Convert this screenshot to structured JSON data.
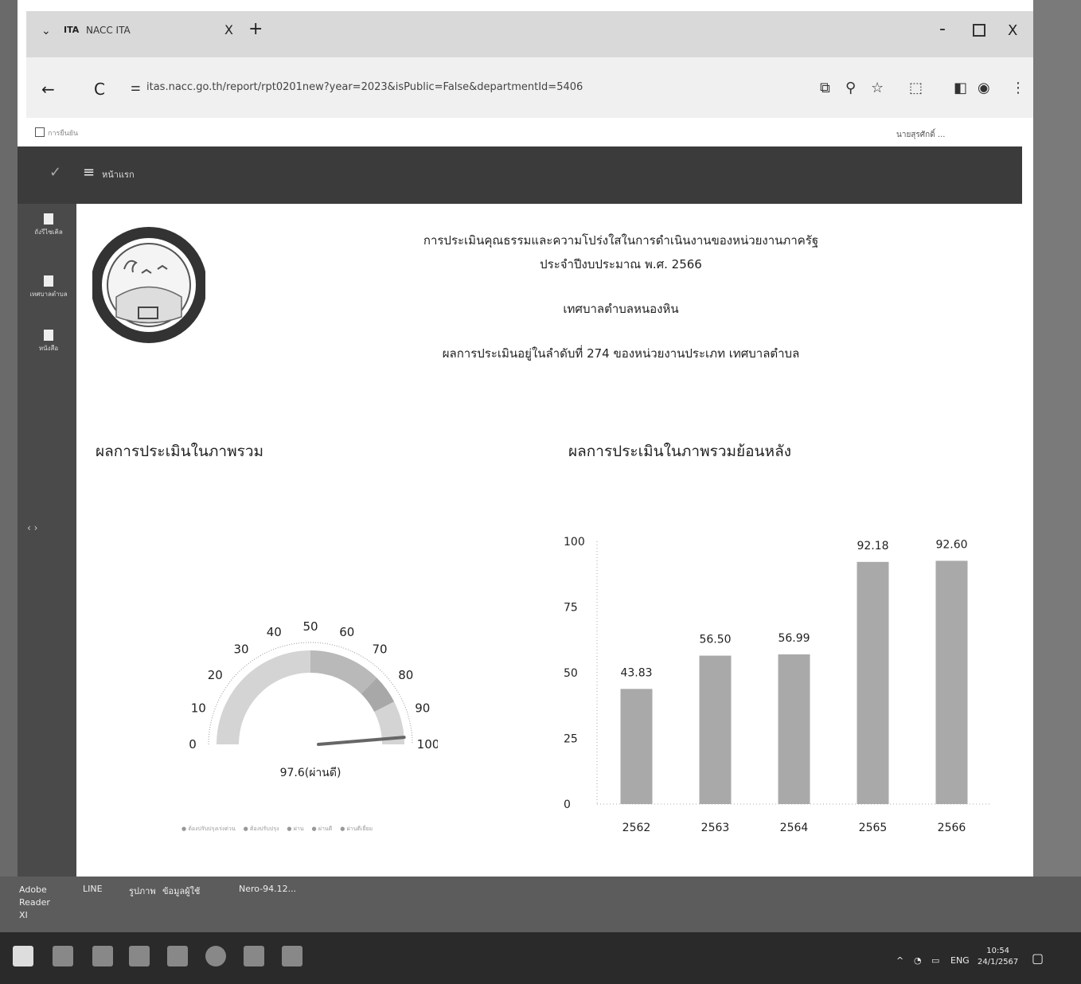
{
  "browser": {
    "tab_arrow": "⌄",
    "favicon_text": "ITA",
    "tab_title": "NACC ITA",
    "tab_close": "X",
    "tab_new": "+",
    "win_min": "-",
    "win_close": "X",
    "url": "itas.nacc.go.th/report/rpt0201new?year=2023&isPublic=False&departmentId=5406",
    "bookmark_text": "การยืนยัน",
    "profile_text": "นายสุรศักดิ์ ..."
  },
  "app": {
    "home_label": "หน้าแรก"
  },
  "sidebar": {
    "items": [
      {
        "label": "ถังรีไซเคิล"
      },
      {
        "label": "เทศบาลตำบล"
      },
      {
        "label": "หนังสือ"
      }
    ],
    "arrows": "‹ ›"
  },
  "report": {
    "title_line1": "การประเมินคุณธรรมและความโปร่งใสในการดำเนินงานของหน่วยงานภาครัฐ",
    "title_line2": "ประจำปีงบประมาณ พ.ศ. 2566",
    "agency": "เทศบาลตำบลหนองหิน",
    "rank_text": "ผลการประเมินอยู่ในลำดับที่ 274 ของหน่วยงานประเภท เทศบาลตำบล",
    "gauge_title": "ผลการประเมินในภาพรวม",
    "history_title": "ผลการประเมินในภาพรวมย้อนหลัง",
    "gauge_value_label": "97.6(ผ่านดี)",
    "gauge_value": 97.6,
    "gauge_ticks": [
      "0",
      "10",
      "20",
      "30",
      "40",
      "50",
      "60",
      "70",
      "80",
      "90",
      "100"
    ],
    "legend": [
      "ต้องปรับปรุงเร่งด่วน",
      "ต้องปรับปรุง",
      "ผ่าน",
      "ผ่านดี",
      "ผ่านดีเยี่ยม"
    ],
    "colors": {
      "gauge_band_light": "#d4d4d4",
      "gauge_band_mid": "#b9b9b9",
      "gauge_band_dark": "#a8a8a8",
      "needle": "#666666",
      "bar": "#a9a9a9"
    }
  },
  "chart_data": {
    "type": "bar",
    "categories": [
      "2562",
      "2563",
      "2564",
      "2565",
      "2566"
    ],
    "values": [
      43.83,
      56.5,
      56.99,
      92.18,
      92.6
    ],
    "value_labels": [
      "43.83",
      "56.50",
      "56.99",
      "92.18",
      "92.60"
    ],
    "ylim": [
      0,
      100
    ],
    "yticks": [
      "0",
      "25",
      "50",
      "75",
      "100"
    ],
    "title": "",
    "xlabel": "",
    "ylabel": ""
  },
  "bottom_apps": [
    "Adobe Reader XI",
    "LINE",
    "รูปภาพ",
    "ข้อมูลผู้ใช้",
    "Nero-94.12..."
  ],
  "tray": {
    "lang": "ENG",
    "time": "10:54",
    "date": "24/1/2567"
  }
}
